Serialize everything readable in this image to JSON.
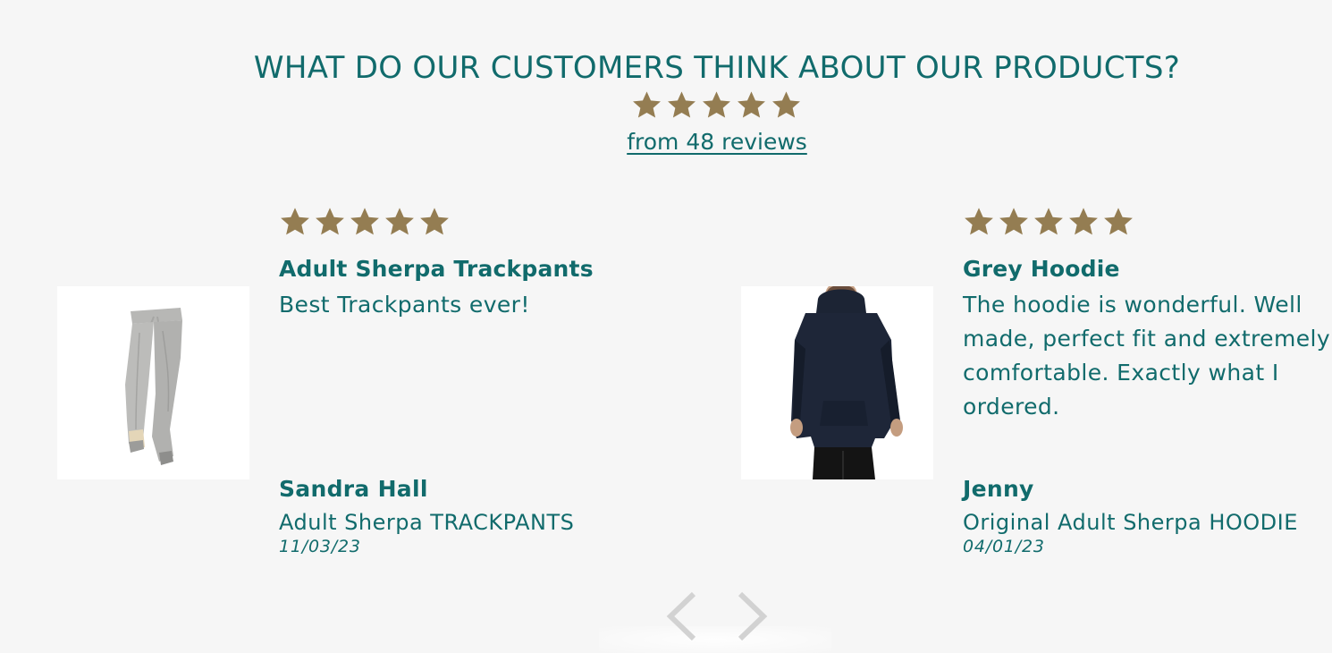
{
  "section": {
    "heading": "WHAT DO OUR CUSTOMERS THINK ABOUT OUR PRODUCTS?",
    "rating_stars": 5,
    "review_count_link": "from 48 reviews"
  },
  "colors": {
    "text": "#116b6c",
    "star": "#947d52",
    "background": "#f6f6f6",
    "arrow": "#d2d2d2"
  },
  "reviews": [
    {
      "stars": 5,
      "title": "Adult Sherpa Trackpants",
      "body": "Best Trackpants ever!",
      "author": "Sandra Hall",
      "product": "Adult Sherpa TRACKPANTS",
      "date": "11/03/23",
      "image": "grey-trackpants-image"
    },
    {
      "stars": 5,
      "title": "Grey Hoodie",
      "body": "The hoodie is wonderful. Well made, perfect fit and extremely comfortable. Exactly what I ordered.",
      "author": "Jenny",
      "product": "Original Adult Sherpa HOODIE",
      "date": "04/01/23",
      "image": "navy-hoodie-image"
    }
  ],
  "navigation": {
    "prev_icon": "chevron-left-icon",
    "next_icon": "chevron-right-icon"
  }
}
